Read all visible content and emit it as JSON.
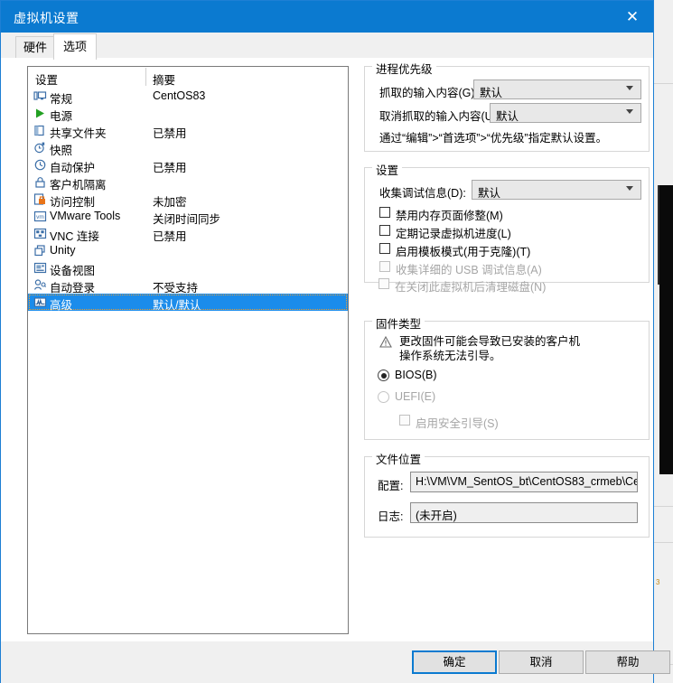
{
  "window": {
    "title": "虚拟机设置",
    "close_label": "✕"
  },
  "tabs": [
    {
      "label": "硬件",
      "active": false
    },
    {
      "label": "选项",
      "active": true
    }
  ],
  "settings_list": {
    "headers": {
      "name": "设置",
      "summary": "摘要"
    },
    "rows": [
      {
        "icon": "monitor-icon",
        "label": "常规",
        "summary": "CentOS83",
        "selected": false
      },
      {
        "icon": "power-play-icon",
        "label": "电源",
        "summary": "",
        "selected": false
      },
      {
        "icon": "shared-folder-icon",
        "label": "共享文件夹",
        "summary": "已禁用",
        "selected": false
      },
      {
        "icon": "snapshot-icon",
        "label": "快照",
        "summary": "",
        "selected": false
      },
      {
        "icon": "autoprotect-icon",
        "label": "自动保护",
        "summary": "已禁用",
        "selected": false
      },
      {
        "icon": "lock-icon",
        "label": "客户机隔离",
        "summary": "",
        "selected": false
      },
      {
        "icon": "access-control-icon",
        "label": "访问控制",
        "summary": "未加密",
        "selected": false
      },
      {
        "icon": "vmware-tools-icon",
        "label": "VMware Tools",
        "summary": "关闭时间同步",
        "selected": false
      },
      {
        "icon": "vnc-icon",
        "label": "VNC 连接",
        "summary": "已禁用",
        "selected": false
      },
      {
        "icon": "unity-icon",
        "label": "Unity",
        "summary": "",
        "selected": false
      },
      {
        "icon": "device-view-icon",
        "label": "设备视图",
        "summary": "",
        "selected": false
      },
      {
        "icon": "autologon-icon",
        "label": "自动登录",
        "summary": "不受支持",
        "selected": false
      },
      {
        "icon": "advanced-icon",
        "label": "高级",
        "summary": "默认/默认",
        "selected": true
      }
    ]
  },
  "priority_group": {
    "legend": "进程优先级",
    "grab_label": "抓取的输入内容(G):",
    "grab_value": "默认",
    "ungrab_label": "取消抓取的输入内容(U):",
    "ungrab_value": "默认",
    "hint": "通过“编辑”>“首选项”>“优先级”指定默认设置。"
  },
  "settings_group": {
    "legend": "设置",
    "debug_label": "收集调试信息(D):",
    "debug_value": "默认",
    "checkboxes": [
      {
        "label": "禁用内存页面修整(M)",
        "checked": false,
        "disabled": false
      },
      {
        "label": "定期记录虚拟机进度(L)",
        "checked": false,
        "disabled": false
      },
      {
        "label": "启用模板模式(用于克隆)(T)",
        "checked": false,
        "disabled": false
      },
      {
        "label": "收集详细的 USB 调试信息(A)",
        "checked": false,
        "disabled": true
      },
      {
        "label": "在关闭此虚拟机后清理磁盘(N)",
        "checked": false,
        "disabled": true
      }
    ]
  },
  "firmware_group": {
    "legend": "固件类型",
    "warning": "更改固件可能会导致已安装的客户机\n操作系统无法引导。",
    "options": [
      {
        "label": "BIOS(B)",
        "checked": true,
        "disabled": false
      },
      {
        "label": "UEFI(E)",
        "checked": false,
        "disabled": true
      }
    ],
    "secure_boot": {
      "label": "启用安全引导(S)",
      "checked": false,
      "disabled": true
    }
  },
  "files_group": {
    "legend": "文件位置",
    "config_label": "配置:",
    "config_value": "H:\\VM\\VM_SentOS_bt\\CentOS83_crmeb\\Ce",
    "log_label": "日志:",
    "log_value": "(未开启)"
  },
  "footer": {
    "ok": "确定",
    "cancel": "取消",
    "help": "帮助"
  },
  "background": {
    "tiny_text": "3"
  },
  "colors": {
    "titlebar": "#0b7ad0",
    "selection": "#1b8ceb",
    "focus_border": "#0b7ad0",
    "dialog_bg": "#f0f0f0"
  }
}
